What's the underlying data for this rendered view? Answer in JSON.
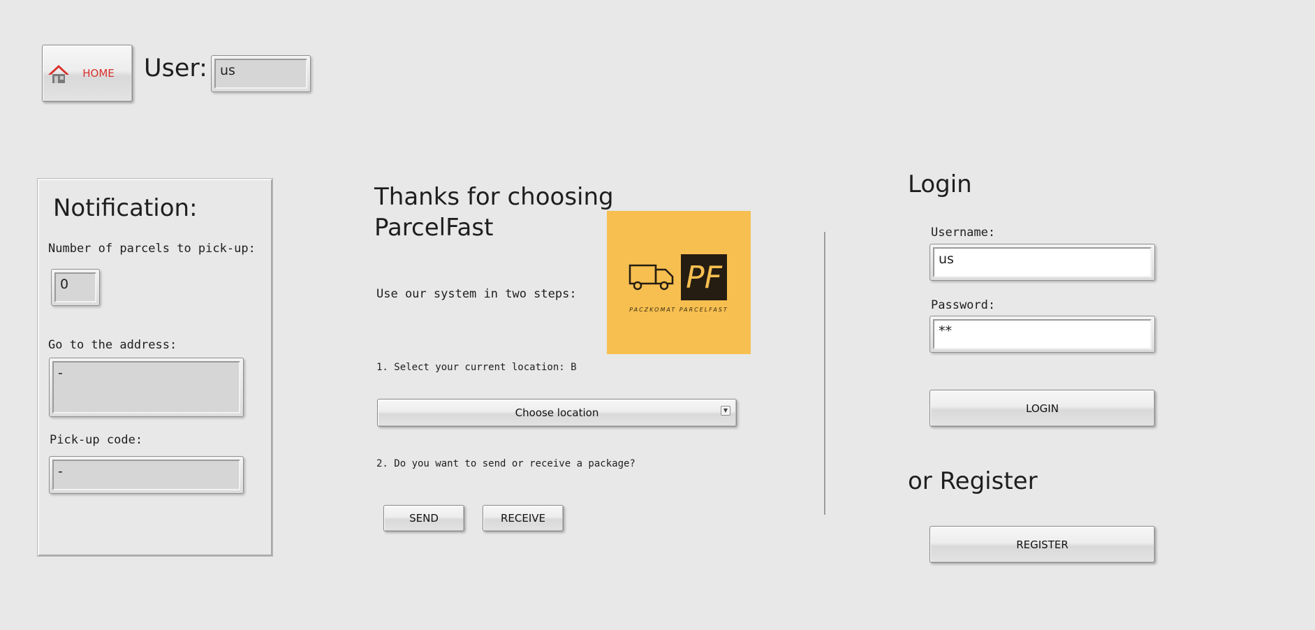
{
  "header": {
    "home_label": "HOME",
    "user_label": "User:",
    "user_value": "us",
    "home_icon_color": "#d9302b"
  },
  "notification": {
    "title": "Notification:",
    "parcels_label": "Number of parcels to pick-up:",
    "parcels_value": "0",
    "address_label": "Go to the address:",
    "address_value": "-",
    "code_label": "Pick-up code:",
    "code_value": "-"
  },
  "main": {
    "title_line1": "Thanks for choosing",
    "title_line2": "ParcelFast",
    "intro": "Use our system in two steps:",
    "step1": "1. Select your current location: B",
    "location_dropdown": "Choose location",
    "step2": "2. Do you want to send or receive a package?",
    "send_label": "SEND",
    "receive_label": "RECEIVE",
    "logo": {
      "initials": "PF",
      "caption": "PACZKOMAT PARCELFAST",
      "background": "#f6bf50",
      "badge_color": "#261d12"
    }
  },
  "login": {
    "title": "Login",
    "username_label": "Username:",
    "username_value": "us",
    "password_label": "Password:",
    "password_value": "**",
    "login_label": "LOGIN",
    "register_title": "or Register",
    "register_label": "REGISTER"
  }
}
